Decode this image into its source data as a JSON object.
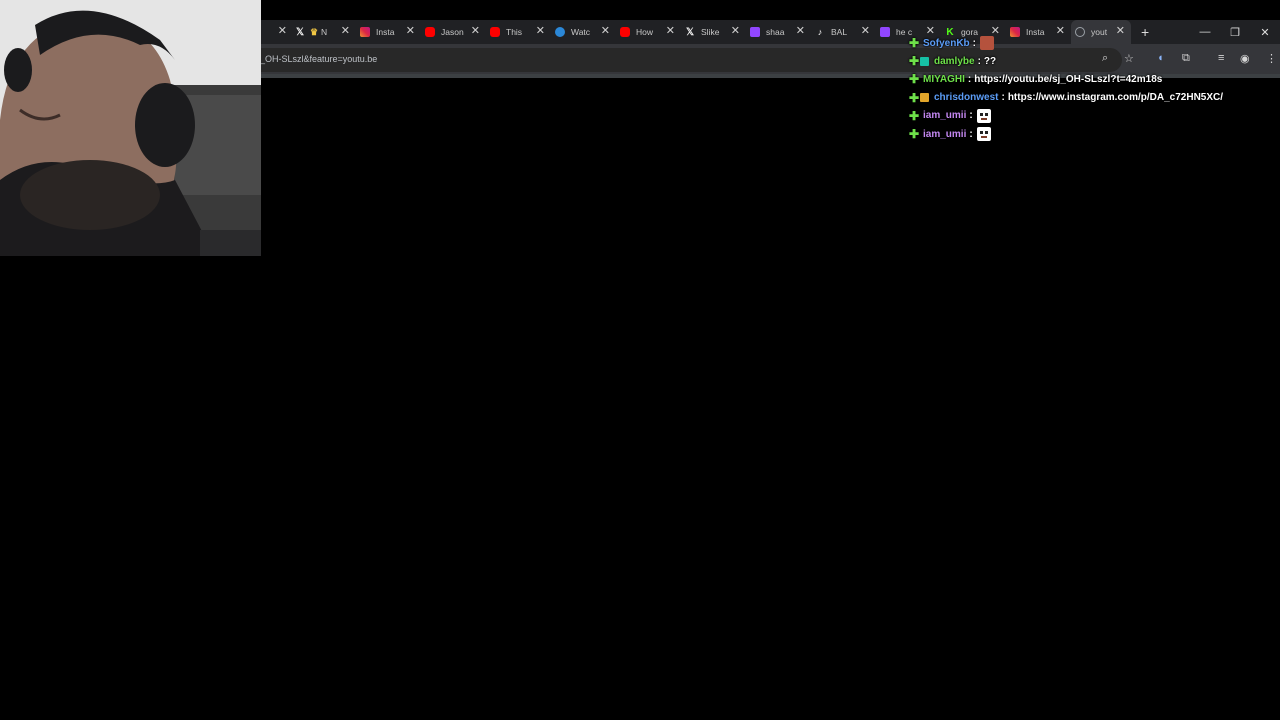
{
  "browser": {
    "tabs": [
      {
        "title": "",
        "icon": "partial-tab-icon",
        "active": false
      },
      {
        "title": "N",
        "icon": "x-logo-icon",
        "icon2": "crown-icon",
        "active": false
      },
      {
        "title": "Insta",
        "icon": "instagram-icon",
        "active": false
      },
      {
        "title": "Jason",
        "icon": "youtube-icon",
        "active": false
      },
      {
        "title": "This",
        "icon": "youtube-icon",
        "active": false
      },
      {
        "title": "Watc",
        "icon": "circle-icon",
        "active": false
      },
      {
        "title": "How",
        "icon": "youtube-icon",
        "active": false
      },
      {
        "title": "Slike",
        "icon": "x-logo-icon",
        "active": false
      },
      {
        "title": "shaa",
        "icon": "twitch-icon",
        "active": false
      },
      {
        "title": "BAL",
        "icon": "tiktok-icon",
        "active": false
      },
      {
        "title": "he c",
        "icon": "twitch-icon",
        "active": false
      },
      {
        "title": "gora",
        "icon": "kick-icon",
        "active": false
      },
      {
        "title": "Insta",
        "icon": "instagram-icon",
        "active": false
      },
      {
        "title": "yout",
        "icon": "loading-icon",
        "active": true
      }
    ],
    "close_glyph": "✕",
    "new_tab_glyph": "+",
    "url": "_OH-SLszl&feature=youtu.be"
  },
  "chat": {
    "messages": [
      {
        "user": "SofyenKb",
        "user_color": "#5b9cf6",
        "badge": "",
        "text": "",
        "emote": "red"
      },
      {
        "user": "damlybe",
        "user_color": "#6ee04a",
        "badge": "teal",
        "text": "??",
        "emote": ""
      },
      {
        "user": "MIYAGHI",
        "user_color": "#6ee04a",
        "badge": "",
        "text": "https://youtu.be/sj_OH-SLszl?t=42m18s",
        "emote": ""
      },
      {
        "user": "chrisdonwest",
        "user_color": "#5b9cf6",
        "badge": "gold",
        "text": "https://www.instagram.com/p/DA_c72HN5XC/",
        "emote": ""
      },
      {
        "user": "iam_umii",
        "user_color": "#c387f0",
        "badge": "",
        "text": "",
        "emote": "face"
      },
      {
        "user": "iam_umii",
        "user_color": "#c387f0",
        "badge": "",
        "text": "",
        "emote": "face"
      }
    ],
    "separator": ":"
  }
}
